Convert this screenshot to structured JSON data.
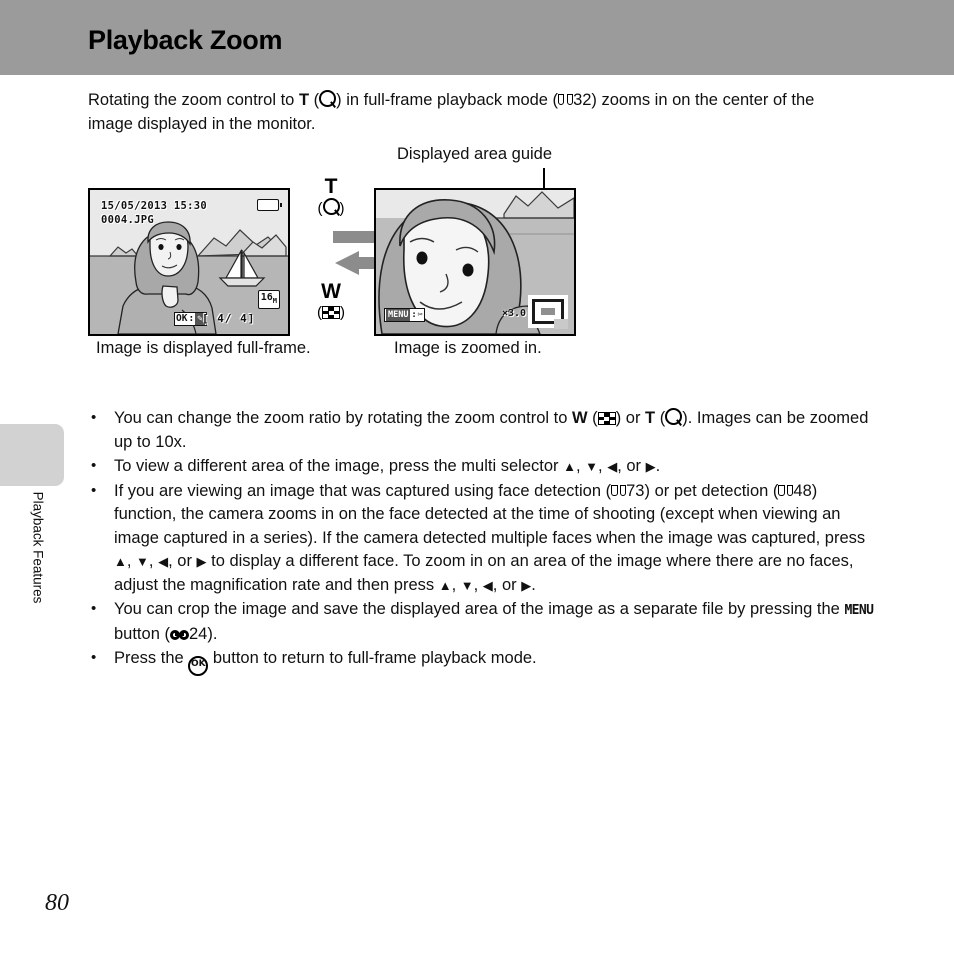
{
  "header": {
    "title": "Playback Zoom"
  },
  "side_tab": {
    "label": "Playback Features"
  },
  "page_number": "80",
  "intro": {
    "part1": "Rotating the zoom control to ",
    "tele_letter": "T",
    "part2": " (",
    "part3": ") in full-frame playback mode (",
    "ref_page": "32",
    "part4": ") zooms in on the center of the image displayed in the monitor."
  },
  "figure": {
    "guide_label": "Displayed area guide",
    "caption_left": "Image is displayed full-frame.",
    "caption_right": "Image is zoomed in.",
    "zoom_control": {
      "tele_letter": "T",
      "tele_symbol": "(⓿)",
      "wide_letter": "W",
      "wide_symbol": "(▦)"
    },
    "screen_left": {
      "date": "15/05/2013",
      "time": "15:30",
      "filename": "0004.JPG",
      "image_size": "16",
      "image_size_sub": "M",
      "ok_label": "OK",
      "frame_counter": "[    4/     4]"
    },
    "screen_right": {
      "menu_label": "MENU",
      "zoom_ratio": "×3.0"
    }
  },
  "bullets": [
    {
      "id": "zoom-ratio",
      "segments": [
        {
          "type": "text",
          "value": "You can change the zoom ratio by rotating the zoom control to "
        },
        {
          "type": "bold",
          "value": "W"
        },
        {
          "type": "text",
          "value": " ("
        },
        {
          "type": "icon",
          "value": "wide-icon"
        },
        {
          "type": "text",
          "value": ") or "
        },
        {
          "type": "bold",
          "value": "T"
        },
        {
          "type": "text",
          "value": " ("
        },
        {
          "type": "icon",
          "value": "tele-icon"
        },
        {
          "type": "text",
          "value": "). Images can be zoomed up to 10x."
        }
      ]
    },
    {
      "id": "multi-selector",
      "segments": [
        {
          "type": "text",
          "value": "To view a different area of the image, press the multi selector "
        },
        {
          "type": "tri",
          "value": "▲"
        },
        {
          "type": "text",
          "value": ", "
        },
        {
          "type": "tri",
          "value": "▼"
        },
        {
          "type": "text",
          "value": ", "
        },
        {
          "type": "tri",
          "value": "◀"
        },
        {
          "type": "text",
          "value": ", or "
        },
        {
          "type": "tri",
          "value": "▶"
        },
        {
          "type": "text",
          "value": "."
        }
      ]
    },
    {
      "id": "face-detection",
      "segments": [
        {
          "type": "text",
          "value": "If you are viewing an image that was captured using face detection ("
        },
        {
          "type": "book",
          "value": "73"
        },
        {
          "type": "text",
          "value": ") or pet detection ("
        },
        {
          "type": "book",
          "value": "48"
        },
        {
          "type": "text",
          "value": ") function, the camera zooms in on the face detected at the time of shooting (except when viewing an image captured in a series). If the camera detected multiple faces when the image was captured, press "
        },
        {
          "type": "tri",
          "value": "▲"
        },
        {
          "type": "text",
          "value": ", "
        },
        {
          "type": "tri",
          "value": "▼"
        },
        {
          "type": "text",
          "value": ", "
        },
        {
          "type": "tri",
          "value": "◀"
        },
        {
          "type": "text",
          "value": ", or "
        },
        {
          "type": "tri",
          "value": "▶"
        },
        {
          "type": "text",
          "value": " to display a different face. To zoom in on an area of the image where there are no faces, adjust the magnification rate and then press "
        },
        {
          "type": "tri",
          "value": "▲"
        },
        {
          "type": "text",
          "value": ", "
        },
        {
          "type": "tri",
          "value": "▼"
        },
        {
          "type": "text",
          "value": ", "
        },
        {
          "type": "tri",
          "value": "◀"
        },
        {
          "type": "text",
          "value": ", or "
        },
        {
          "type": "tri",
          "value": "▶"
        },
        {
          "type": "text",
          "value": "."
        }
      ]
    },
    {
      "id": "crop-image",
      "segments": [
        {
          "type": "text",
          "value": "You can crop the image and save the displayed area of the image as a separate file by pressing the "
        },
        {
          "type": "menu",
          "value": "MENU"
        },
        {
          "type": "text",
          "value": " button ("
        },
        {
          "type": "sb",
          "value": "24"
        },
        {
          "type": "text",
          "value": ")."
        }
      ]
    },
    {
      "id": "return-fullframe",
      "segments": [
        {
          "type": "text",
          "value": "Press the "
        },
        {
          "type": "ok",
          "value": "OK"
        },
        {
          "type": "text",
          "value": " button to return to full-frame playback mode."
        }
      ]
    }
  ],
  "colors": {
    "header_band": "#9b9b9b",
    "side_tab": "#d2d2d2",
    "screen_sea": "#b6b6b6",
    "screen_sky": "#e9e9e9"
  }
}
